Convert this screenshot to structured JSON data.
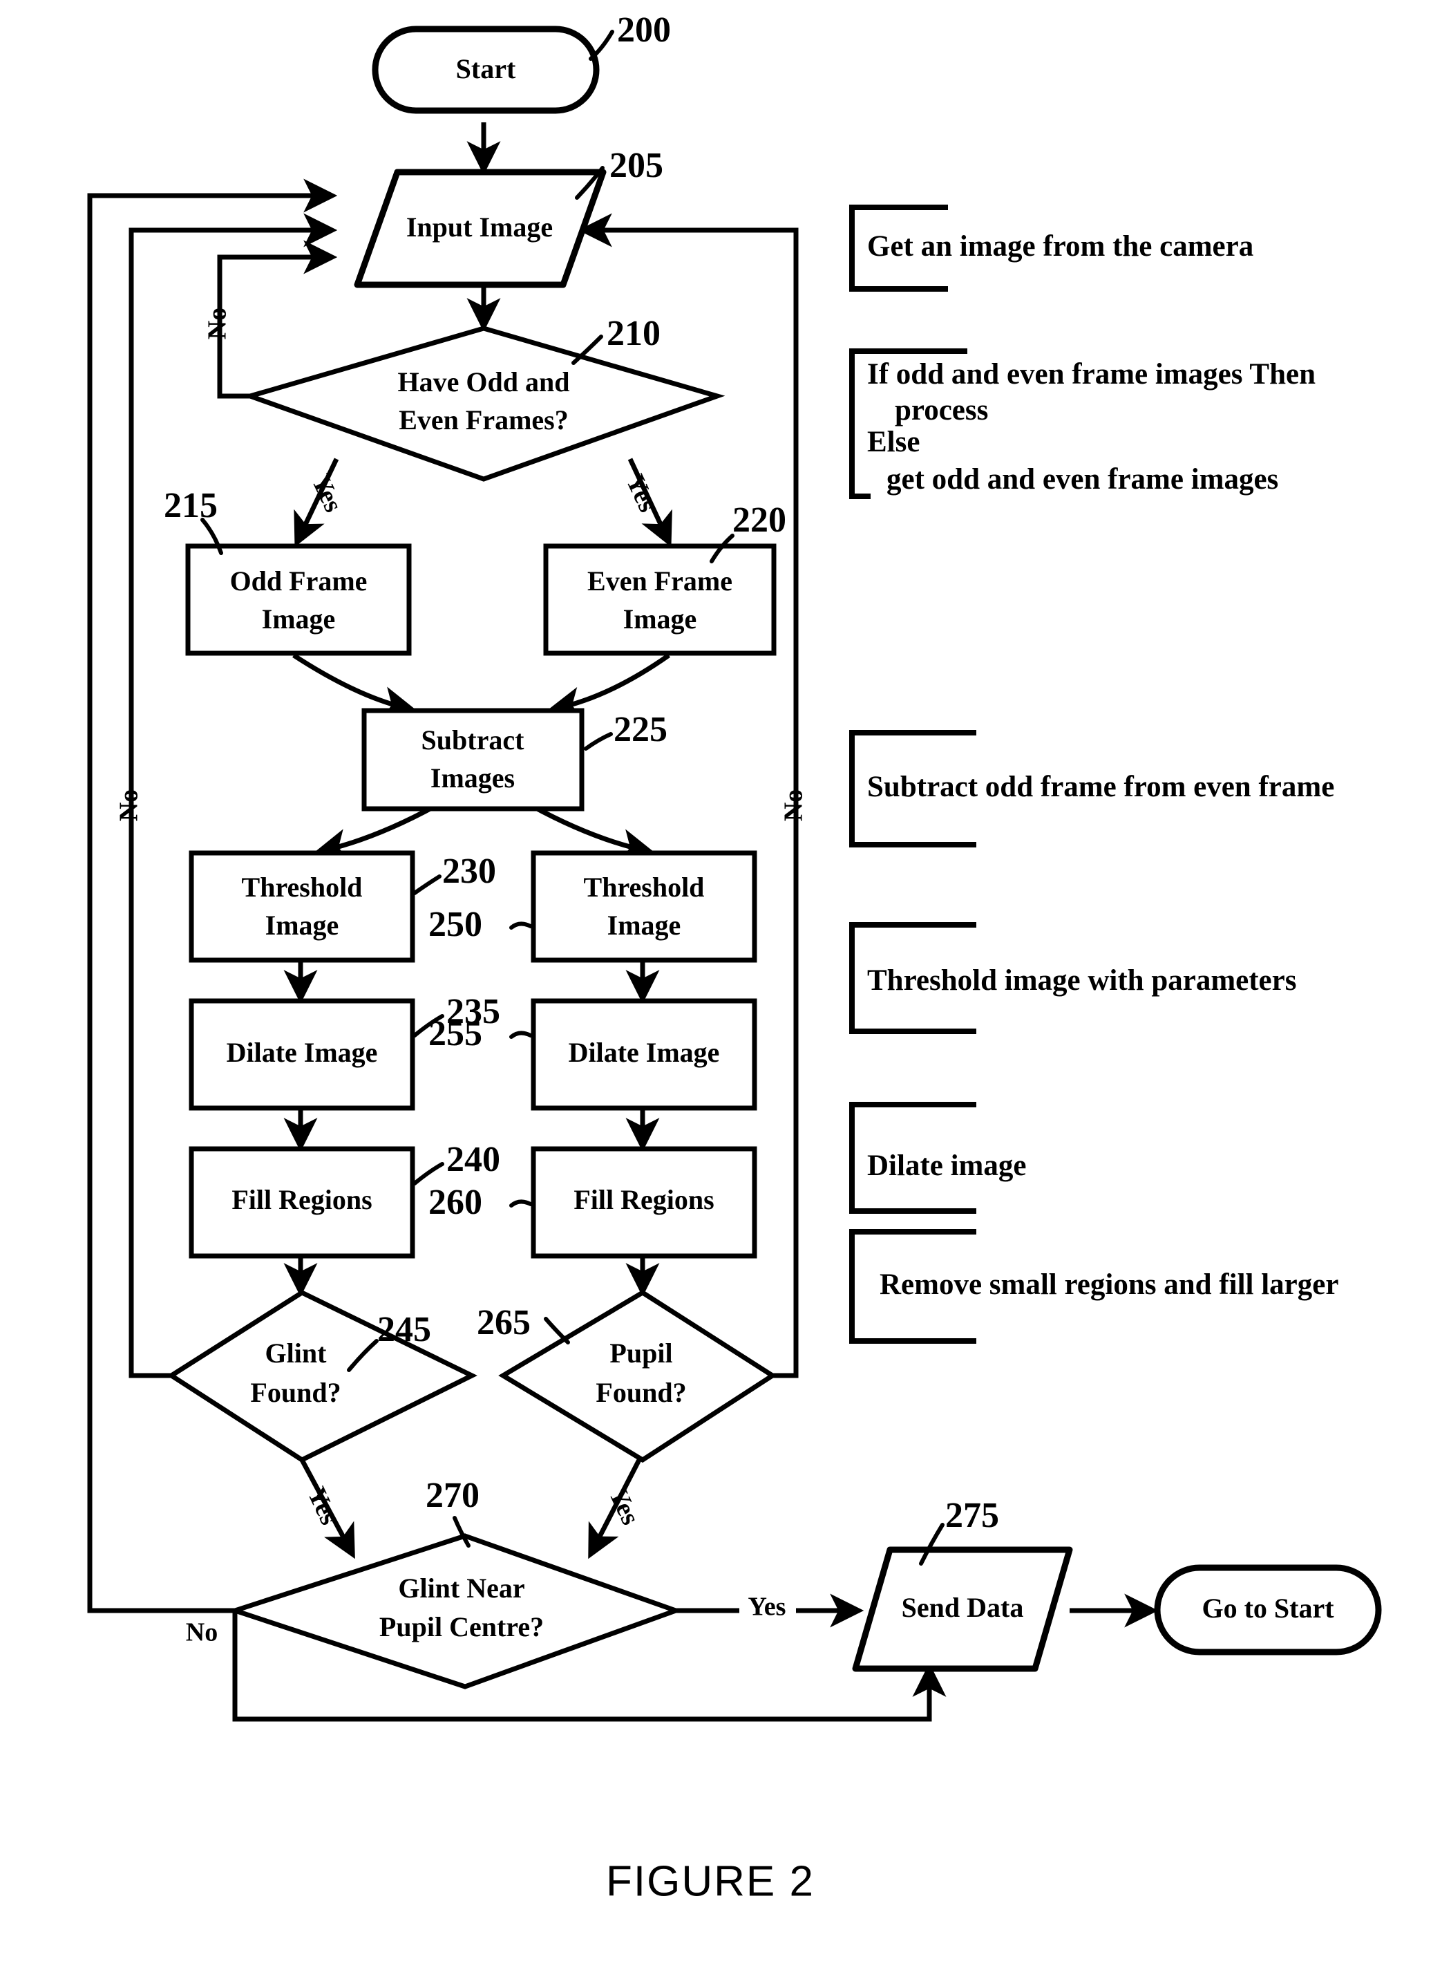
{
  "figure": {
    "caption": "FIGURE 2"
  },
  "nodes": {
    "start": {
      "label": "Start",
      "ref": "200",
      "shape": "terminator"
    },
    "input_image": {
      "label": "Input Image",
      "ref": "205",
      "shape": "io"
    },
    "have_frames": {
      "label_line1": "Have Odd and",
      "label_line2": "Even Frames?",
      "ref": "210",
      "shape": "decision"
    },
    "odd_frame": {
      "label_line1": "Odd Frame",
      "label_line2": "Image",
      "ref": "215",
      "shape": "process"
    },
    "even_frame": {
      "label_line1": "Even Frame",
      "label_line2": "Image",
      "ref": "220",
      "shape": "process"
    },
    "subtract": {
      "label_line1": "Subtract",
      "label_line2": "Images",
      "ref": "225",
      "shape": "process"
    },
    "threshold_left": {
      "label_line1": "Threshold",
      "label_line2": "Image",
      "ref": "230",
      "shape": "process"
    },
    "threshold_right": {
      "label_line1": "Threshold",
      "label_line2": "Image",
      "ref": "250",
      "shape": "process"
    },
    "dilate_left": {
      "label": "Dilate Image",
      "ref": "235",
      "shape": "process"
    },
    "dilate_right": {
      "label": "Dilate Image",
      "ref": "255",
      "shape": "process"
    },
    "fill_left": {
      "label": "Fill Regions",
      "ref": "240",
      "shape": "process"
    },
    "fill_right": {
      "label": "Fill Regions",
      "ref": "260",
      "shape": "process"
    },
    "glint_found": {
      "label_line1": "Glint",
      "label_line2": "Found?",
      "ref": "245",
      "shape": "decision"
    },
    "pupil_found": {
      "label_line1": "Pupil",
      "label_line2": "Found?",
      "ref": "265",
      "shape": "decision"
    },
    "glint_near_pupil": {
      "label_line1": "Glint Near",
      "label_line2": "Pupil Centre?",
      "ref": "270",
      "shape": "decision"
    },
    "send_data": {
      "label": "Send Data",
      "ref": "275",
      "shape": "io"
    },
    "go_to_start": {
      "label": "Go to Start",
      "ref": "",
      "shape": "terminator"
    }
  },
  "edge_labels": {
    "have_frames_no": "No",
    "have_frames_yes_left": "Yes",
    "have_frames_yes_right": "Yes",
    "glint_found_no": "No",
    "glint_found_yes": "Yes",
    "pupil_found_no": "No",
    "pupil_found_yes": "Yes",
    "glint_near_pupil_no": "No",
    "glint_near_pupil_yes": "Yes"
  },
  "notes": [
    {
      "lines": [
        "Get an image from the camera"
      ],
      "indents": [
        0
      ]
    },
    {
      "lines": [
        "If   odd and even frame images Then",
        "process",
        "Else",
        "get odd and even frame images"
      ],
      "indents": [
        0,
        40,
        0,
        28
      ]
    },
    {
      "lines": [
        "Subtract odd frame from even frame"
      ],
      "indents": [
        0
      ]
    },
    {
      "lines": [
        "Threshold image with parameters"
      ],
      "indents": [
        0
      ]
    },
    {
      "lines": [
        "Dilate image"
      ],
      "indents": [
        0
      ]
    },
    {
      "lines": [
        "Remove small regions and fill larger"
      ],
      "indents": [
        18
      ]
    }
  ]
}
